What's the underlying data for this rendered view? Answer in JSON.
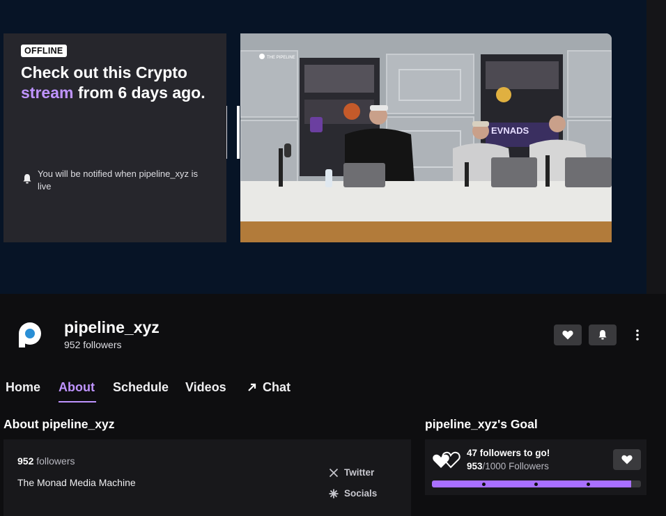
{
  "player": {
    "status_badge": "OFFLINE",
    "headline_pre": "Check out this Crypto ",
    "headline_link": "stream",
    "headline_post": " from 6 days ago.",
    "notify_text": "You will be notified when pipeline_xyz is live",
    "video_overlay_logo": "THE PIPELINE",
    "video_neon_sign": "EVNADS"
  },
  "channel": {
    "name": "pipeline_xyz",
    "followers_line": "952 followers",
    "avatar_icon": "pipeline-logo-icon",
    "follow_icon": "heart-icon",
    "notify_icon": "bell-icon",
    "more_icon": "kebab-menu-icon"
  },
  "tabs": [
    {
      "label": "Home"
    },
    {
      "label": "About",
      "active": true
    },
    {
      "label": "Schedule"
    },
    {
      "label": "Videos"
    },
    {
      "label": "Chat",
      "icon": "external-arrow-icon"
    }
  ],
  "about": {
    "title": "About pipeline_xyz",
    "followers_count": "952",
    "followers_word": "followers",
    "bio": "The Monad Media Machine",
    "links": [
      {
        "label": "Twitter",
        "icon": "x-logo-icon"
      },
      {
        "label": "Socials",
        "icon": "sparkle-icon"
      }
    ]
  },
  "goal": {
    "title": "pipeline_xyz's Goal",
    "remaining_text": "47 followers to go!",
    "current": "953",
    "target_text": "/1000 Followers",
    "progress_fraction": 0.953,
    "icon": "double-heart-icon",
    "follow_icon": "heart-icon"
  },
  "colors": {
    "accent": "#bf94ff",
    "progress": "#a970ff",
    "top_band": "#071426",
    "page_bg": "#0e0e10",
    "card_bg": "#18181b",
    "avatar_blue": "#2a8fd6"
  }
}
